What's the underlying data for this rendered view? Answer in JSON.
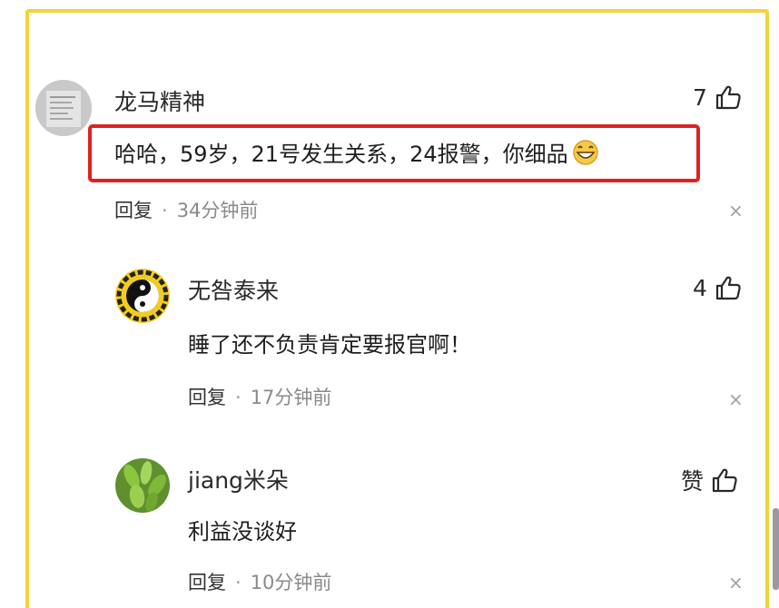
{
  "comments": [
    {
      "user": "龙马精神",
      "text": "哈哈，59岁，21号发生关系，24报警，你细品",
      "reply_label": "回复",
      "separator": "·",
      "time": "34分钟前",
      "likes": "7",
      "avatar_icon": "document-photo-avatar"
    },
    {
      "user": "无咎泰来",
      "text": "睡了还不负责肯定要报官啊！",
      "reply_label": "回复",
      "separator": "·",
      "time": "17分钟前",
      "likes": "4",
      "avatar_icon": "yin-yang-avatar"
    },
    {
      "user": "jiang米朵",
      "text": "利益没谈好",
      "reply_label": "回复",
      "separator": "·",
      "time": "10分钟前",
      "likes": "赞",
      "avatar_icon": "green-plant-avatar"
    }
  ],
  "close_glyph": "×",
  "colors": {
    "frame": "#f5d23a",
    "highlight": "#e02020",
    "meta": "#8a8a8a"
  }
}
